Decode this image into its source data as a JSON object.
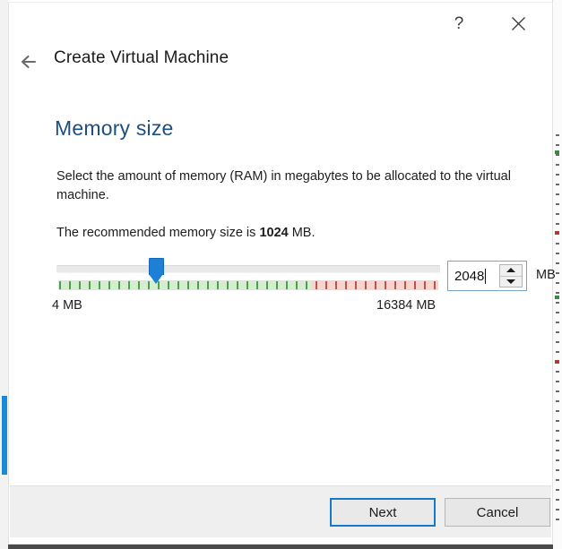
{
  "window": {
    "wizard_title": "Create Virtual Machine",
    "back_icon": "back-arrow-icon",
    "help_label": "?",
    "close_icon": "close-icon"
  },
  "page": {
    "title": "Memory size",
    "description_line": "Select the amount of memory (RAM) in megabytes to be allocated to the virtual machine.",
    "recommend_prefix": "The recommended memory size is ",
    "recommend_value": "1024",
    "recommend_suffix": " MB."
  },
  "slider": {
    "min_label": "4 MB",
    "max_label": "16384 MB",
    "min_value": 4,
    "max_value": 16384,
    "current_value": 2048,
    "handle_position_percent": 24,
    "safe_zone_percent": 67,
    "colors": {
      "handle": "#1f7fd4",
      "groove": "#e9e9e9",
      "scale_safe": "#d6edd2",
      "scale_safe_tick": "#4f9e52",
      "scale_warn": "#f6d5d0",
      "scale_warn_tick": "#b9564a"
    }
  },
  "spinbox": {
    "value": "2048",
    "unit": "MB",
    "up_icon": "spinner-up-icon",
    "down_icon": "spinner-down-icon"
  },
  "footer": {
    "next_label": "Next",
    "cancel_label": "Cancel",
    "default_button": "Next"
  },
  "theme": {
    "accent": "#1878c8",
    "heading": "#1f4f80",
    "dialog_bg": "#ffffff",
    "footer_bg": "#efefef"
  }
}
